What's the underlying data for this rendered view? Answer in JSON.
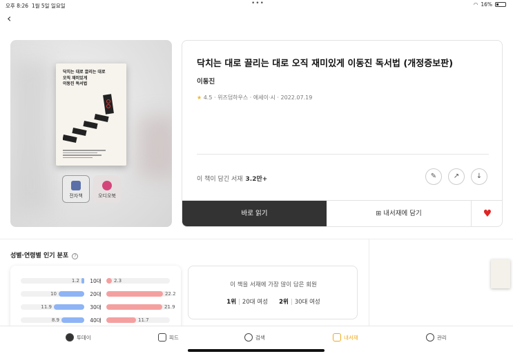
{
  "status_bar": {
    "time": "오후 8:26",
    "date": "1월 5일 일요일",
    "dots": "•••",
    "battery": "16%"
  },
  "book": {
    "title": "닥치는 대로 끌리는 대로 오직 재미있게 이동진 독서법 (개정증보판)",
    "cover_title_lines": [
      "닥치는 대로 끌리는 대로",
      "오직 재미있게",
      "이동진 독서법"
    ],
    "author": "이동진",
    "rating": "4.5",
    "publisher": "위즈덤하우스",
    "category": "에세이·시",
    "date": "2022.07.19",
    "shelf_label": "이 책이 담긴 서재",
    "shelf_count": "3.2만+"
  },
  "formats": [
    {
      "label": "전자책"
    },
    {
      "label": "오디오북"
    }
  ],
  "actions": {
    "read": "바로 읽기",
    "save": "내서재에 담기"
  },
  "popularity": {
    "title": "성별·연령별 인기 분포",
    "most_saved_title": "이 책을 서재에 가장 많이 담은 회원",
    "rank1": {
      "rank": "1위",
      "label": "20대 여성"
    },
    "rank2": {
      "rank": "2위",
      "label": "30대 여성"
    }
  },
  "chart_data": {
    "type": "bar",
    "categories": [
      "10대",
      "20대",
      "30대",
      "40대"
    ],
    "series": [
      {
        "values": [
          1.2,
          10,
          11.9,
          8.9
        ]
      },
      {
        "values": [
          2.3,
          22.2,
          21.9,
          11.7
        ]
      }
    ],
    "colors": [
      "#8eb4f5",
      "#f4a0a0"
    ]
  },
  "tabs": [
    {
      "label": "투데이",
      "icon": "today-icon"
    },
    {
      "label": "피드",
      "icon": "feed-icon"
    },
    {
      "label": "검색",
      "icon": "search-icon"
    },
    {
      "label": "내서재",
      "icon": "library-icon",
      "active": true
    },
    {
      "label": "관리",
      "icon": "settings-icon"
    }
  ],
  "colors": {
    "accent": "#f0a91a",
    "heart": "#e02424",
    "dark_button": "#333333"
  }
}
